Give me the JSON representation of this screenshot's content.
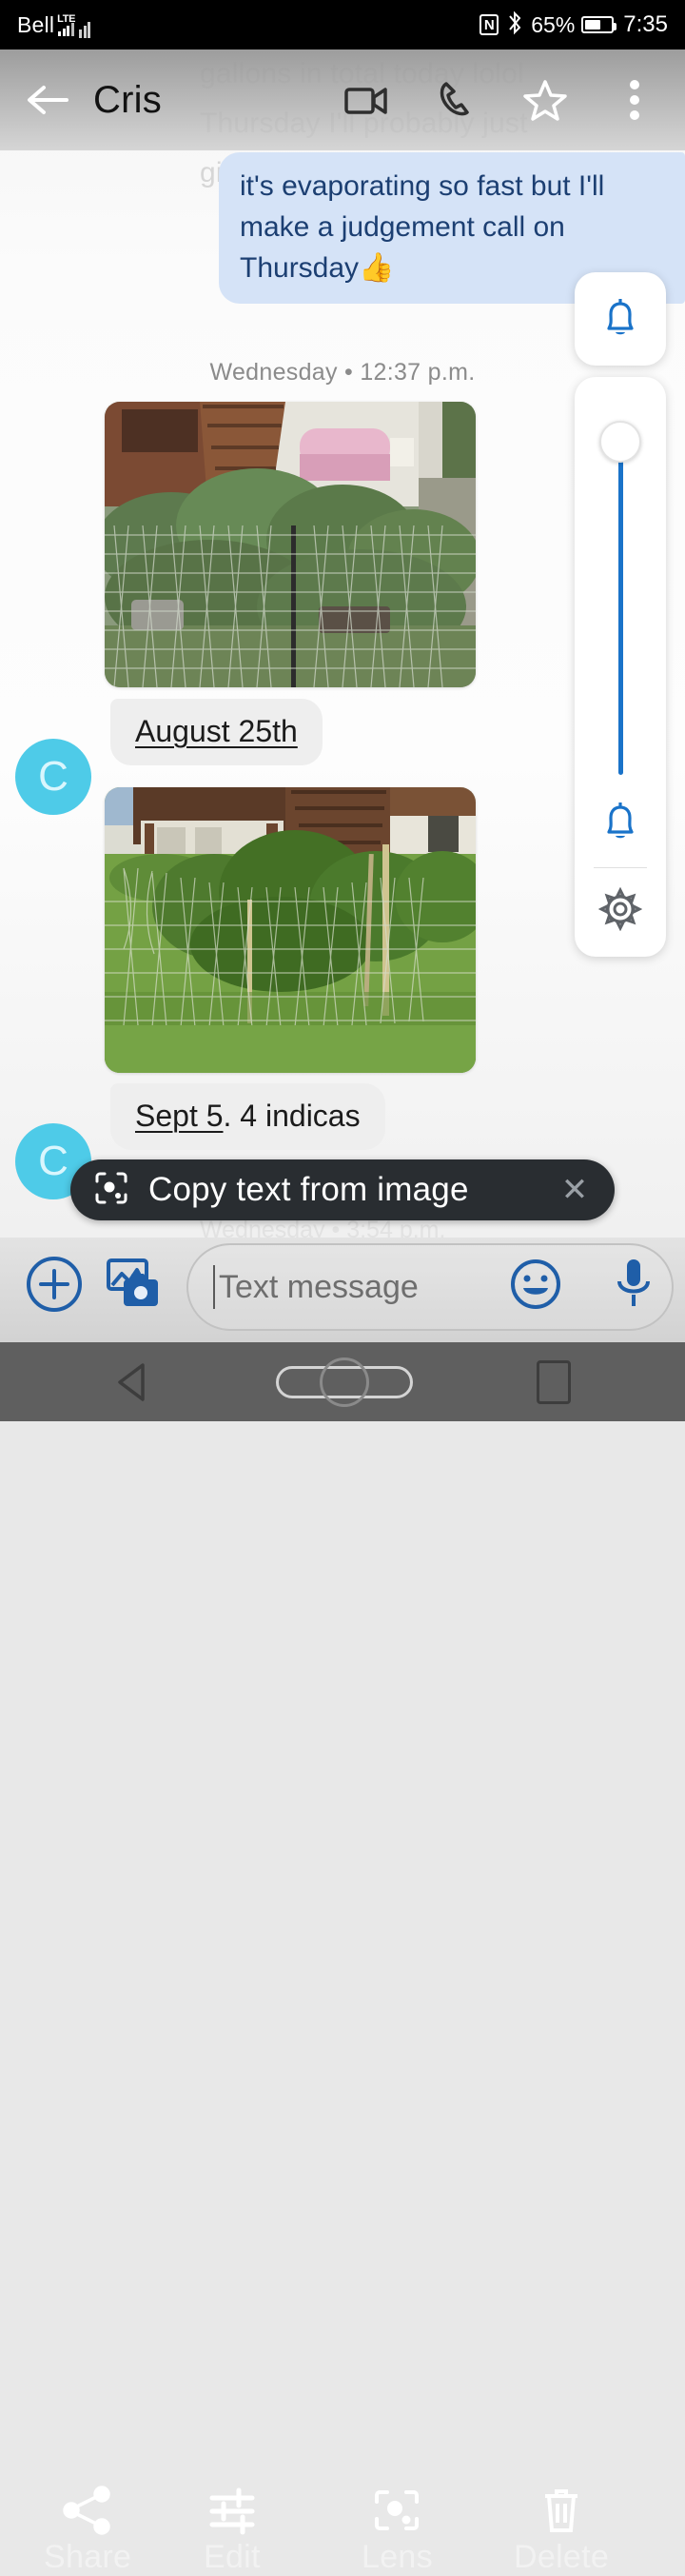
{
  "status_bar": {
    "carrier": "Bell",
    "network": "LTE",
    "nfc_icon": "nfc-icon",
    "bluetooth_icon": "bluetooth-icon",
    "battery_percent": "65%",
    "battery_icon": "battery-icon",
    "clock": "7:35"
  },
  "app_bar": {
    "back_icon": "back-arrow-icon",
    "contact_name": "Cris",
    "video_call_icon": "video-camera-icon",
    "voice_call_icon": "phone-icon",
    "favorite_icon": "star-icon",
    "overflow_icon": "more-vertical-icon"
  },
  "background_text": {
    "line1": "gallons in total today lolol",
    "line2": "Thursday I'll probably just",
    "line3": "give most of them water",
    "bottom_timestamp": "Wednesday • 3:54 p.m."
  },
  "conversation": {
    "outgoing_message": "it's evaporating so fast but I'll make a judgement call on Thursday",
    "outgoing_emoji": "👍",
    "day_divider": "Wednesday • 12:37 p.m.",
    "messages": [
      {
        "avatar_letter": "C",
        "photo_alt": "backyard-garden-plants-behind-chicken-wire",
        "caption_underlined": "August 25th",
        "caption_rest": ""
      },
      {
        "avatar_letter": "C",
        "photo_alt": "backyard-lawn-plants-with-fence-posts",
        "caption_underlined": "Sept 5",
        "caption_rest": ". 4 indicas"
      }
    ]
  },
  "volume_panel": {
    "ring_button_icon": "bell-icon",
    "slider_icon": "volume-slider",
    "slider_value": "92",
    "notification_bell_icon": "bell-icon",
    "settings_icon": "gear-icon"
  },
  "toast": {
    "icon": "lens-text-icon",
    "label": "Copy text from image",
    "close_icon": "close-icon"
  },
  "compose_bar": {
    "add_icon": "plus-circle-icon",
    "gallery_icon": "gallery-camera-icon",
    "placeholder": "Text message",
    "value": "",
    "emoji_icon": "emoji-smiley-icon",
    "mic_icon": "microphone-icon"
  },
  "action_bar": {
    "items": [
      {
        "icon": "share-icon",
        "label": "Share"
      },
      {
        "icon": "edit-tune-icon",
        "label": "Edit"
      },
      {
        "icon": "lens-icon",
        "label": "Lens"
      },
      {
        "icon": "trash-icon",
        "label": "Delete"
      }
    ]
  },
  "nav_bar": {
    "back_icon": "nav-back-icon",
    "home_icon": "nav-home-icon",
    "recents_icon": "nav-recents-icon"
  },
  "colors": {
    "accent_blue": "#1a73c9",
    "bubble_out": "#d5e3f7",
    "bubble_out_text": "#1c3f72",
    "bubble_in": "#eeeeee",
    "avatar": "#4ecbe8",
    "toast_bg": "#292d31"
  }
}
